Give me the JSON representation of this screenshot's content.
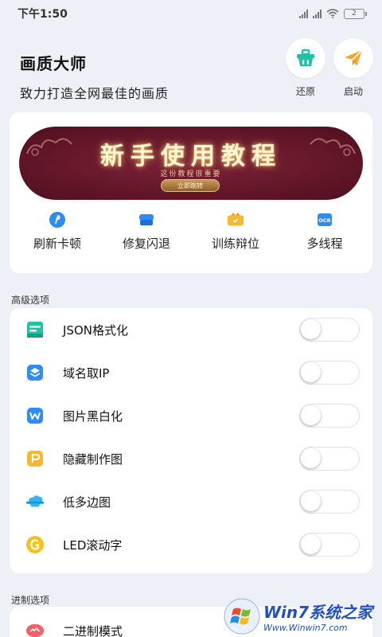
{
  "status_bar": {
    "time": "下午1:50",
    "battery": "2"
  },
  "header": {
    "title": "画质大师",
    "subtitle": "致力打造全网最佳的画质",
    "actions": [
      {
        "label": "还原",
        "icon": "basket-icon",
        "color": "#1ec3a3"
      },
      {
        "label": "启动",
        "icon": "paper-plane-icon",
        "color": "#f5a623"
      }
    ]
  },
  "banner": {
    "title": "新手使用教程",
    "subtitle": "这份教程很重要",
    "button": "立即跳转"
  },
  "quick_actions": [
    {
      "label": "刷新卡顿",
      "icon": "refresh-icon",
      "color": "#2f8cf5"
    },
    {
      "label": "修复闪退",
      "icon": "repair-icon",
      "color": "#2f8cf5"
    },
    {
      "label": "训练辩位",
      "icon": "training-icon",
      "color": "#f7b733"
    },
    {
      "label": "多线程",
      "icon": "ocr-icon",
      "color": "#2f8cf5"
    }
  ],
  "advanced": {
    "section_label": "高级选项",
    "items": [
      {
        "label": "JSON格式化",
        "icon": "json-icon",
        "color": "#1ec3a3",
        "enabled": false
      },
      {
        "label": "域名取IP",
        "icon": "layers-icon",
        "color": "#2f8cf5",
        "enabled": false
      },
      {
        "label": "图片黑白化",
        "icon": "w-doc-icon",
        "color": "#2f8cf5",
        "enabled": false
      },
      {
        "label": "隐藏制作图",
        "icon": "p-doc-icon",
        "color": "#f7b733",
        "enabled": false
      },
      {
        "label": "低多边图",
        "icon": "cloud-icon",
        "color": "#2fb5f5",
        "enabled": false
      },
      {
        "label": "LED滚动字",
        "icon": "g-circle-icon",
        "color": "#f7c21d",
        "enabled": false
      }
    ]
  },
  "binary": {
    "section_label": "进制选项",
    "items": [
      {
        "label": "二进制模式",
        "icon": "binary-icon",
        "color": "#f5616b"
      }
    ]
  },
  "watermark": {
    "line1": "Win7系统之家",
    "line2": "Www.Winwin7.com"
  }
}
